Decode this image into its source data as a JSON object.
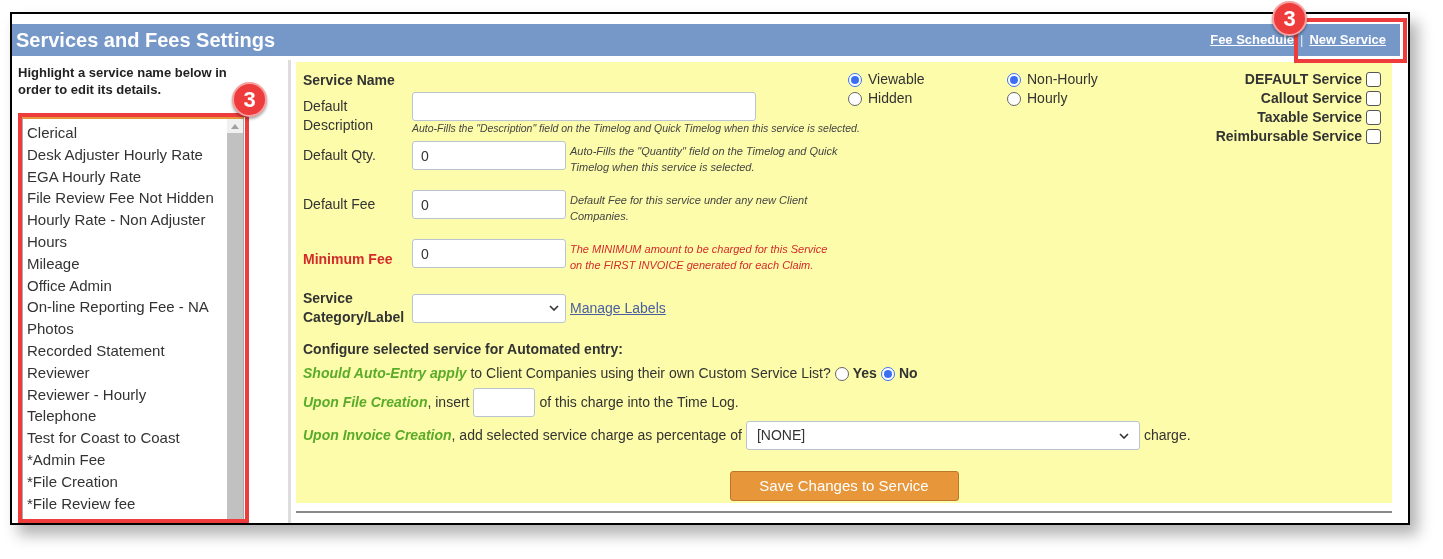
{
  "header": {
    "title": "Services and Fees Settings",
    "links": [
      {
        "label": "Fee Schedule"
      },
      {
        "label": "New Service"
      }
    ],
    "separator": "|"
  },
  "sidebar": {
    "instruction": "Highlight a service name below in order to edit its details.",
    "services": [
      {
        "label": "Clerical"
      },
      {
        "label": "Desk Adjuster Hourly Rate"
      },
      {
        "label": "EGA Hourly Rate"
      },
      {
        "label": "File Review Fee Not Hidden"
      },
      {
        "label": "Hourly Rate - Non Adjuster"
      },
      {
        "label": "Hours"
      },
      {
        "label": "Mileage"
      },
      {
        "label": "Office Admin"
      },
      {
        "label": "On-line Reporting Fee - NA"
      },
      {
        "label": "Photos"
      },
      {
        "label": "Recorded Statement"
      },
      {
        "label": "Reviewer"
      },
      {
        "label": "Reviewer - Hourly"
      },
      {
        "label": "Telephone"
      },
      {
        "label": "Test for Coast to Coast"
      },
      {
        "label": "*Admin Fee"
      },
      {
        "label": "*File Creation"
      },
      {
        "label": "*File Review fee"
      }
    ]
  },
  "form": {
    "service_name_label": "Service Name",
    "fields": [
      {
        "label": "Default Description",
        "wide": true,
        "emphasis": false,
        "hint": "Auto-Fills the \"Description\" field on the Timelog and Quick Timelog when this service is selected."
      },
      {
        "label": "Default Qty.",
        "value": "0",
        "wide": false,
        "emphasis": false,
        "hint": "Auto-Fills the \"Quantity\" field on the Timelog and Quick Timelog when this service is selected."
      },
      {
        "label": "Default Fee",
        "value": "0",
        "wide": false,
        "emphasis": false,
        "hint": "Default Fee for this service under any new Client Companies."
      },
      {
        "label": "Minimum Fee",
        "value": "0",
        "wide": false,
        "emphasis": true,
        "hint": "The MINIMUM amount to be charged for this Service on the FIRST INVOICE generated for each Claim."
      }
    ],
    "category": {
      "label": "Service Category/Label",
      "link": "Manage Labels"
    },
    "visibility": [
      {
        "label": "Viewable",
        "selected": true
      },
      {
        "label": "Hidden",
        "selected": false
      }
    ],
    "billing": [
      {
        "label": "Non-Hourly",
        "selected": true
      },
      {
        "label": "Hourly",
        "selected": false
      }
    ],
    "flags": [
      {
        "label": "DEFAULT Service",
        "checked": false
      },
      {
        "label": "Callout Service",
        "checked": false
      },
      {
        "label": "Taxable Service",
        "checked": false
      },
      {
        "label": "Reimbursable Service",
        "checked": false
      }
    ],
    "automation": {
      "heading": "Configure selected service for Automated entry:",
      "auto_entry": {
        "question": "*Should Auto-Entry apply* to Client Companies using their own Custom Service List?",
        "options": [
          {
            "label": "Yes",
            "selected": false
          },
          {
            "label": "No",
            "selected": true
          }
        ]
      },
      "file_creation": {
        "before": "*Upon File Creation*, insert",
        "after": "of this charge into the Time Log."
      },
      "invoice_creation": {
        "before": "*Upon Invoice Creation*, add selected service charge as percentage of",
        "select": "[NONE]",
        "after": "charge."
      }
    },
    "save_button": "Save Changes to Service"
  },
  "annotations": [
    {
      "label": "3"
    },
    {
      "label": "3"
    }
  ]
}
